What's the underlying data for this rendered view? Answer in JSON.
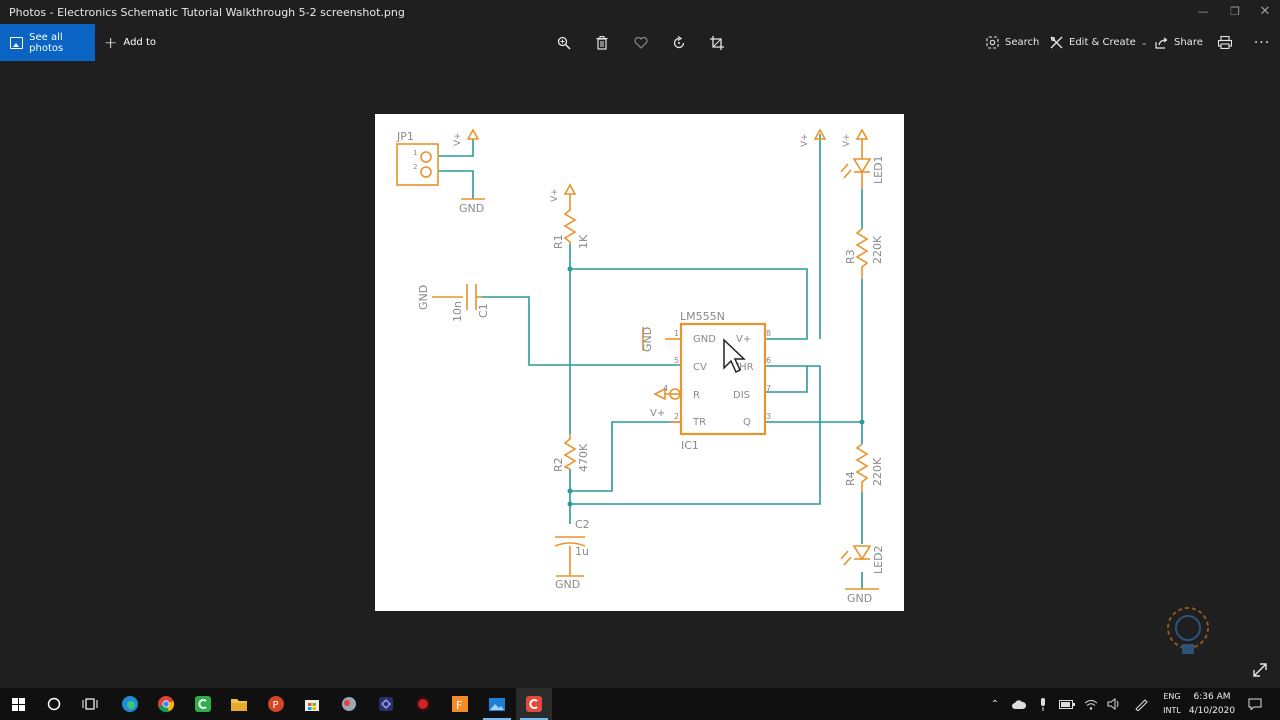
{
  "window": {
    "title": "Photos - Electronics Schematic Tutorial Walkthrough 5-2 screenshot.png"
  },
  "toolbar": {
    "see_all_label": "See all photos",
    "add_to_label": "Add to",
    "search_label": "Search",
    "edit_create_label": "Edit & Create",
    "share_label": "Share"
  },
  "schematic": {
    "jp1": "JP1",
    "jp1_pin1": "1",
    "jp1_pin2": "2",
    "vplus": "V+",
    "gnd": "GND",
    "r1": "R1",
    "r1_val": "1K",
    "c1": "C1",
    "c1_val": "10n",
    "ic_name": "LM555N",
    "ic_ref": "IC1",
    "pin_gnd": "GND",
    "pin_vplus": "V+",
    "pin_cv": "CV",
    "pin_thr": "THR",
    "pin_r": "R",
    "pin_dis": "DIS",
    "pin_tr": "TR",
    "pin_q": "Q",
    "pinnum1": "1",
    "pinnum5": "5",
    "pinnum4": "4",
    "pinnum2": "2",
    "pinnum8": "8",
    "pinnum6": "6",
    "pinnum7": "7",
    "pinnum3": "3",
    "r2": "R2",
    "r2_val": "470K",
    "c2": "C2",
    "c2_val": "1u",
    "r3": "R3",
    "r3_val": "220K",
    "r4": "R4",
    "r4_val": "220K",
    "led1": "LED1",
    "led2": "LED2",
    "colors": {
      "component": "#e8932c",
      "wire": "#2a9a9a",
      "text": "#888888"
    }
  },
  "tray": {
    "lang_top": "ENG",
    "lang_bottom": "INTL",
    "time": "6:36 AM",
    "date": "4/10/2020"
  },
  "icons": {
    "taskbar": [
      "windows-start-icon",
      "cortana-circle-icon",
      "task-view-icon",
      "edge-icon",
      "chrome-icon",
      "camtasia-icon",
      "file-explorer-icon",
      "powerpoint-icon",
      "store-icon",
      "app-icon",
      "app-icon-2",
      "davinci-icon",
      "fusion-icon",
      "photos-icon",
      "camtasia-recorder-icon"
    ]
  }
}
